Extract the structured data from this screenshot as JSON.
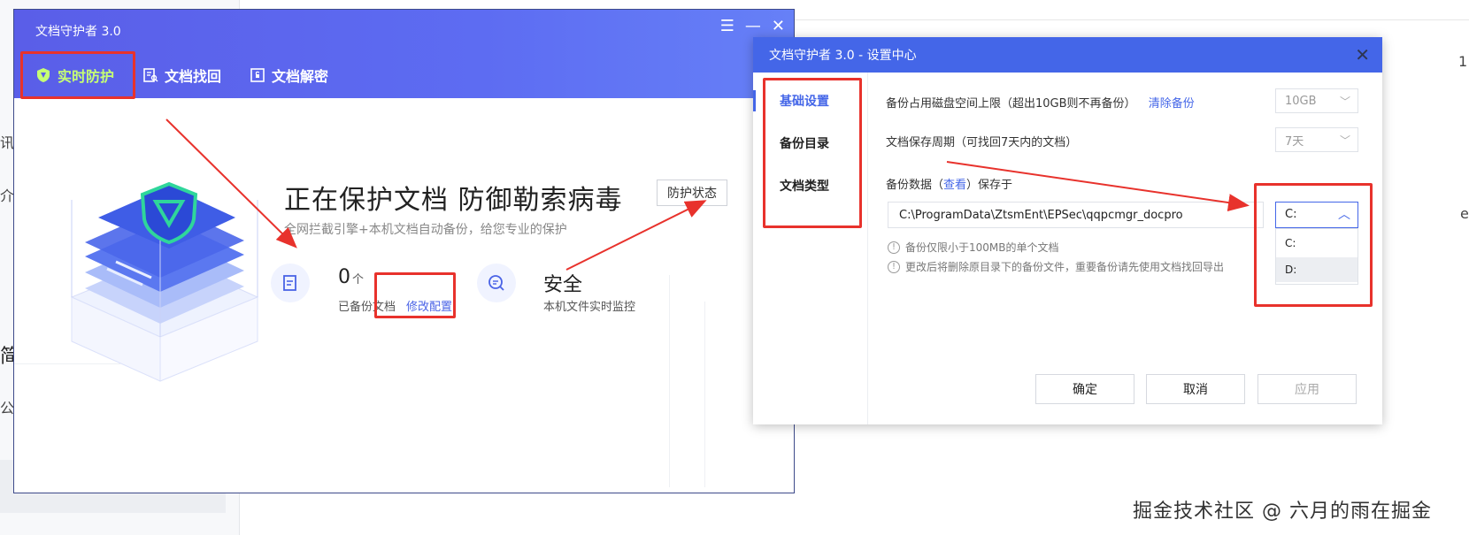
{
  "background": {
    "left_chars": [
      "讯",
      "介",
      "简",
      "公"
    ],
    "right_chars": [
      "1",
      "e"
    ],
    "watermark": "掘金技术社区 @ 六月的雨在掘金"
  },
  "main_window": {
    "title": "文档守护者 3.0",
    "controls": {
      "menu": "☰",
      "minimize": "—",
      "close": "✕"
    },
    "tabs": [
      {
        "label": "实时防护"
      },
      {
        "label": "文档找回"
      },
      {
        "label": "文档解密"
      }
    ],
    "headline": "正在保护文档 防御勒索病毒",
    "subline": "全网拦截引擎+本机文档自动备份，给您专业的保护",
    "status_button": "防护状态",
    "backup": {
      "count": "0",
      "unit": "个",
      "label": "已备份文档",
      "link": "修改配置"
    },
    "safety": {
      "title": "安全",
      "label": "本机文件实时监控"
    }
  },
  "settings_window": {
    "title": "文档守护者 3.0 - 设置中心",
    "close": "✕",
    "nav": [
      {
        "label": "基础设置"
      },
      {
        "label": "备份目录"
      },
      {
        "label": "文档类型"
      }
    ],
    "disk_limit": {
      "label": "备份占用磁盘空间上限（超出10GB则不再备份）",
      "link": "清除备份",
      "value": "10GB"
    },
    "retention": {
      "label": "文档保存周期（可找回7天内的文档）",
      "value": "7天"
    },
    "backup_data": {
      "prefix": "备份数据（",
      "link": "查看",
      "suffix": "）保存于"
    },
    "path": "C:\\ProgramData\\ZtsmEnt\\EPSec\\qqpcmgr_docpro",
    "drive": {
      "selected": "C:",
      "options": [
        "C:",
        "D:"
      ]
    },
    "notes": [
      "备份仅限小于100MB的单个文档",
      "更改后将删除原目录下的备份文件，重要备份请先使用文档找回导出"
    ],
    "buttons": {
      "ok": "确定",
      "cancel": "取消",
      "apply": "应用"
    }
  },
  "colors": {
    "header_blue": "#5d6cf2",
    "dialog_blue": "#4466e8",
    "active_tab": "#c6ff73",
    "highlight_red": "#e8322c",
    "shield_green": "#2fd69b"
  }
}
